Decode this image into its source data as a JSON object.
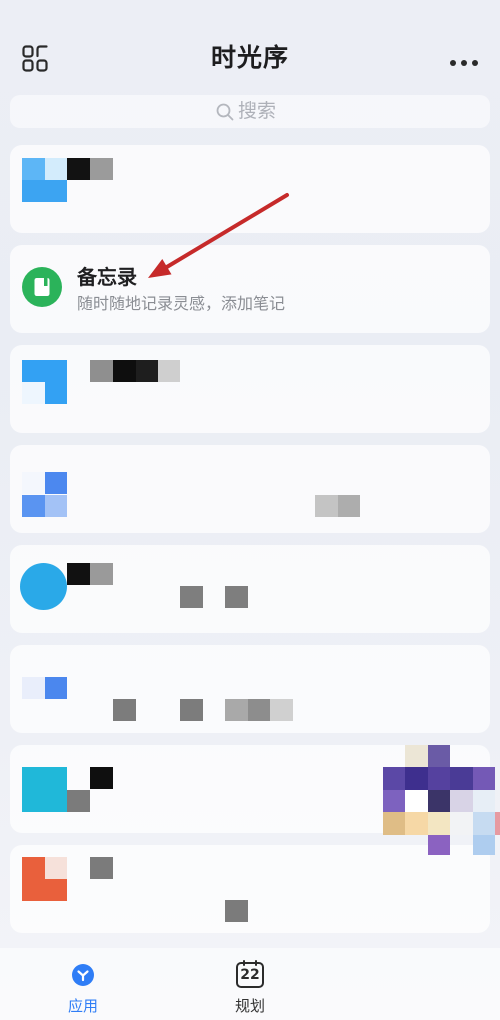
{
  "header": {
    "title": "时光序",
    "left_icon": "apps-grid-icon",
    "right_icon": "more-dots-icon"
  },
  "search": {
    "placeholder": "搜索",
    "icon": "search-icon"
  },
  "list": {
    "items": [
      {
        "title": "备忘录",
        "subtitle": "随时随地记录灵感，添加笔记",
        "icon": "notebook-icon"
      }
    ]
  },
  "tabs": [
    {
      "label": "应用",
      "icon": "app-hub-icon",
      "active": true
    },
    {
      "label": "规划",
      "icon": "calendar-icon",
      "date": "22",
      "active": false
    }
  ],
  "colors": {
    "accent": "#2f7df6",
    "memo_icon_bg": "#2bb35a",
    "annotation_arrow": "#c62a2a"
  }
}
